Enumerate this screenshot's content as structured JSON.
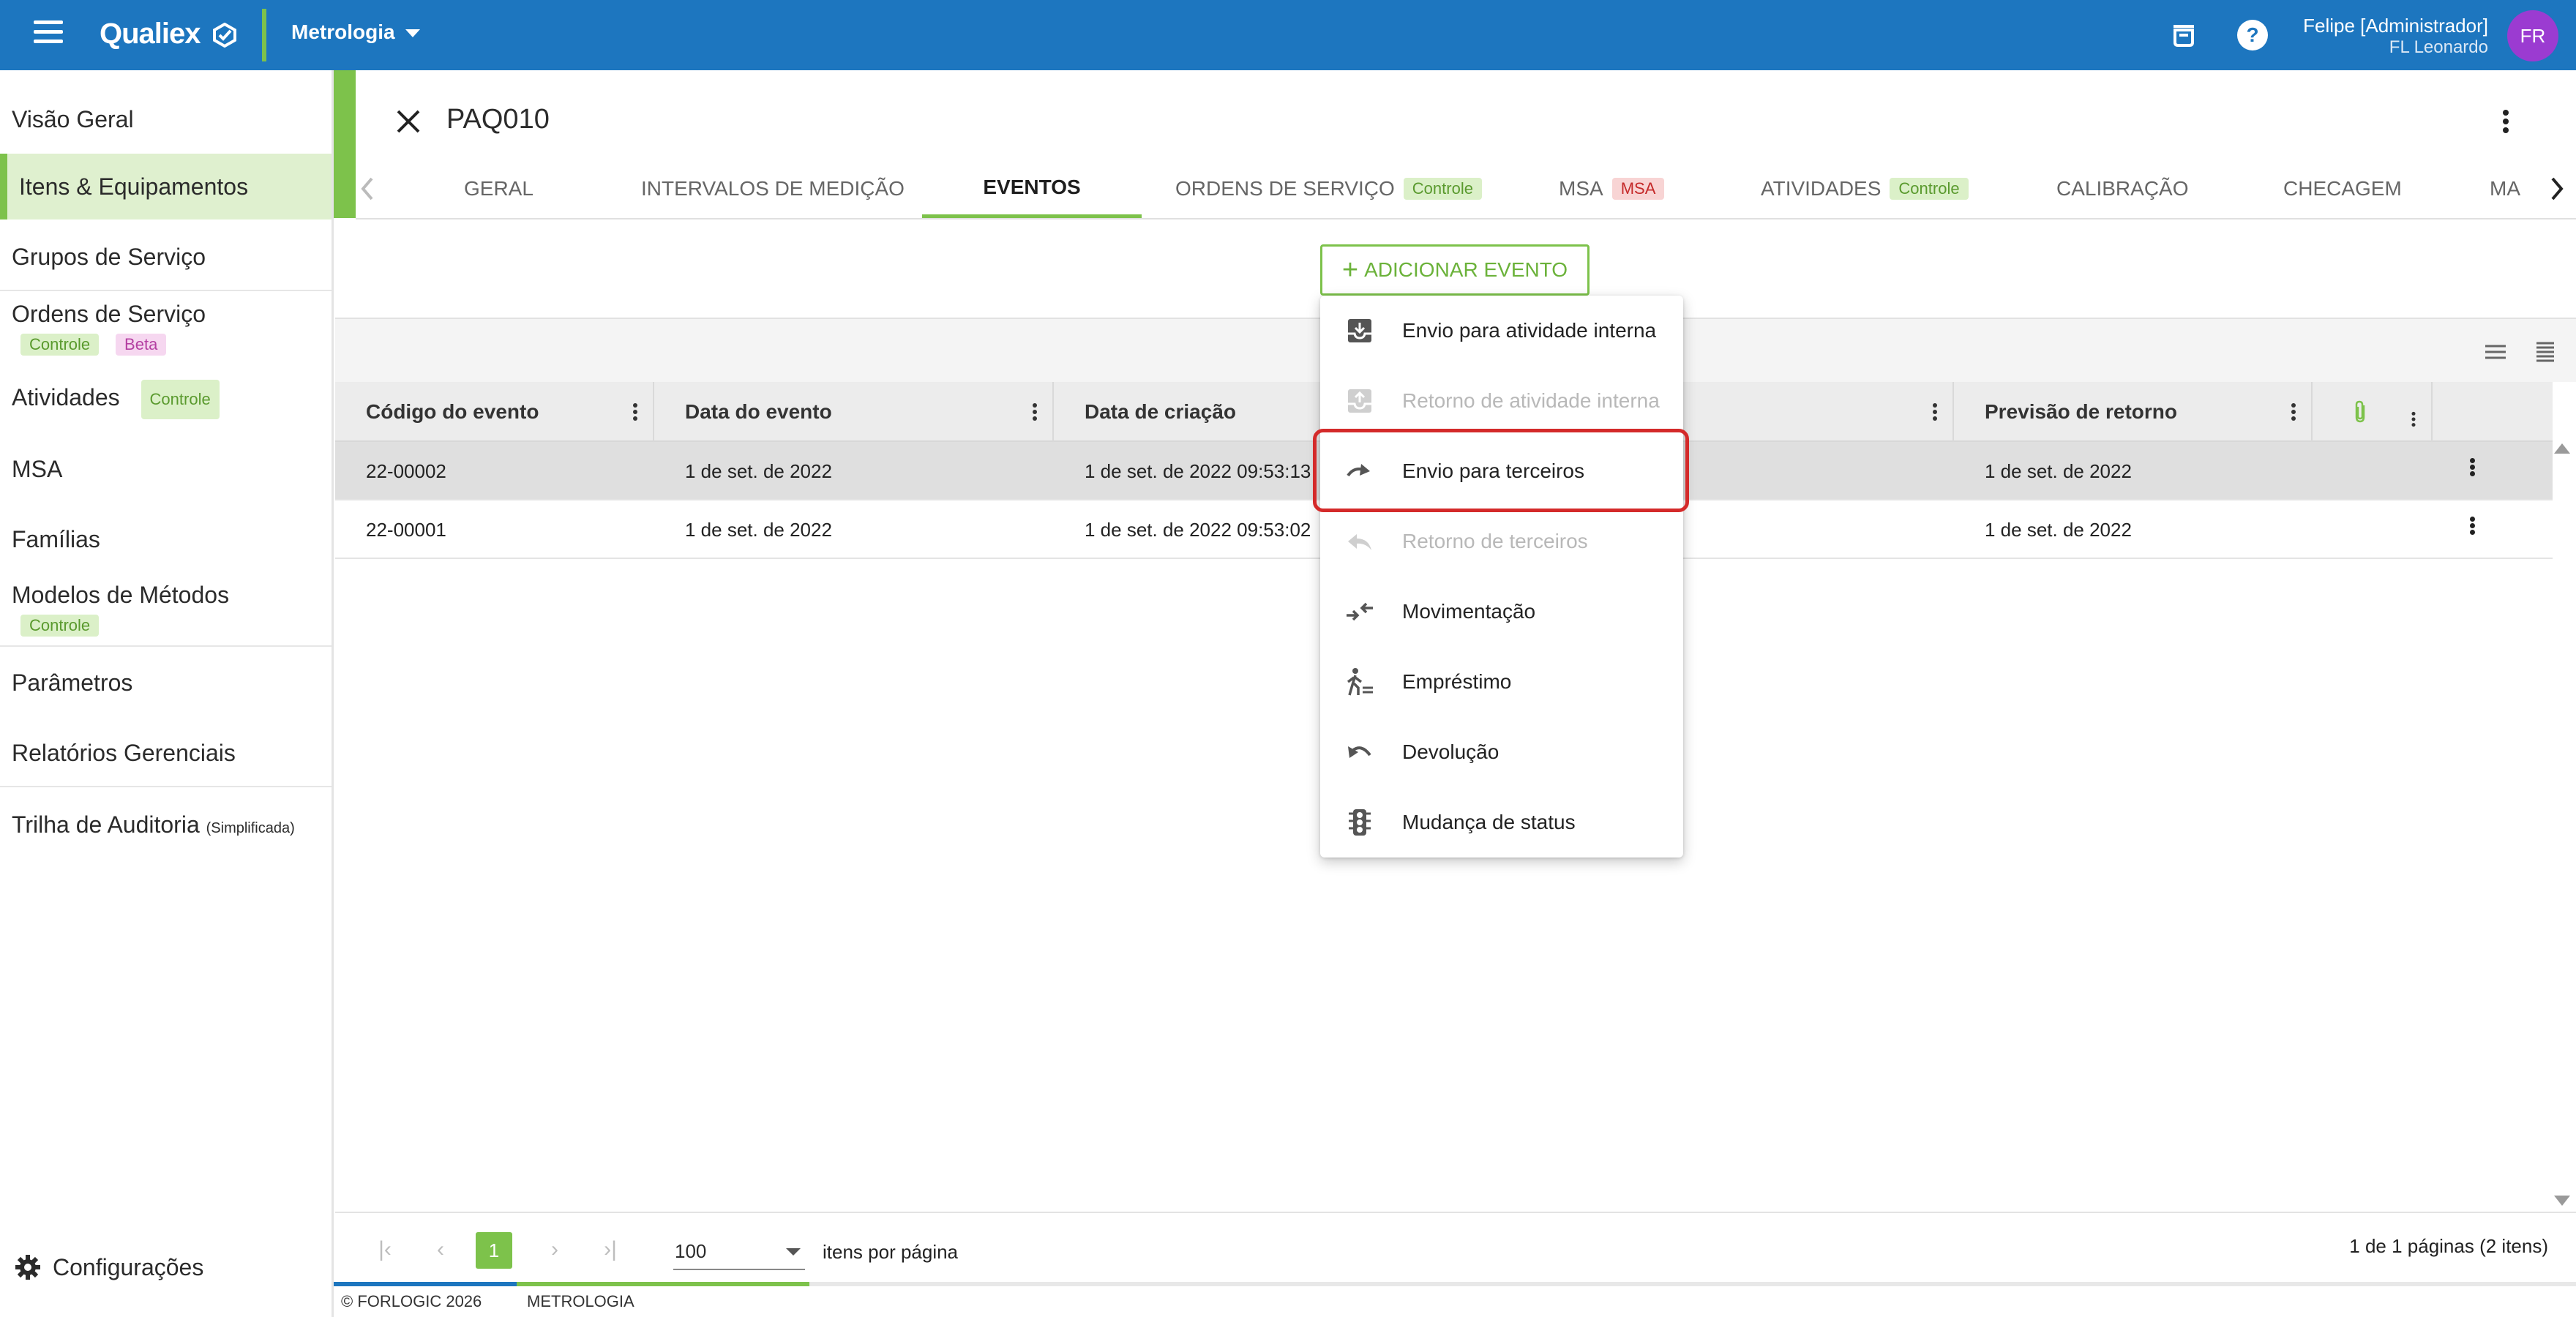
{
  "topbar": {
    "brand": "Qualiex",
    "module": "Metrologia",
    "user_name": "Felipe [Administrador]",
    "user_company": "FL Leonardo",
    "avatar_initials": "FR"
  },
  "sidebar": {
    "items": [
      {
        "label": "Visão Geral"
      },
      {
        "label": "Itens & Equipamentos"
      },
      {
        "label": "Grupos de Serviço"
      },
      {
        "label": "Ordens de Serviço",
        "tags": [
          "Controle",
          "Beta"
        ]
      },
      {
        "label": "Atividades",
        "tags": [
          "Controle"
        ]
      },
      {
        "label": "MSA"
      },
      {
        "label": "Famílias"
      },
      {
        "label": "Modelos de Métodos",
        "tags": [
          "Controle"
        ]
      },
      {
        "label": "Parâmetros"
      },
      {
        "label": "Relatórios Gerenciais"
      },
      {
        "label": "Trilha de Auditoria",
        "note": "(Simplificada)"
      }
    ],
    "settings_label": "Configurações"
  },
  "page": {
    "title": "PAQ010",
    "tabs": [
      {
        "label": "GERAL"
      },
      {
        "label": "INTERVALOS DE MEDIÇÃO"
      },
      {
        "label": "EVENTOS"
      },
      {
        "label": "ORDENS DE SERVIÇO",
        "tag": "Controle"
      },
      {
        "label": "MSA",
        "tag": "MSA"
      },
      {
        "label": "ATIVIDADES",
        "tag": "Controle"
      },
      {
        "label": "CALIBRAÇÃO"
      },
      {
        "label": "CHECAGEM"
      },
      {
        "label": "MA"
      }
    ],
    "add_button": "ADICIONAR EVENTO"
  },
  "table": {
    "columns": [
      "Código do evento",
      "Data do evento",
      "Data de criação",
      "Previsão de retorno"
    ],
    "rows": [
      {
        "code": "22-00002",
        "event_date": "1 de set. de 2022",
        "created": "1 de set. de 2022 09:53:13",
        "return": "1 de set. de 2022"
      },
      {
        "code": "22-00001",
        "event_date": "1 de set. de 2022",
        "created": "1 de set. de 2022 09:53:02",
        "return": "1 de set. de 2022"
      }
    ]
  },
  "menu": {
    "items": [
      {
        "label": "Envio para atividade interna",
        "icon": "inbox-out-icon",
        "enabled": true
      },
      {
        "label": "Retorno de atividade interna",
        "icon": "inbox-in-icon",
        "enabled": false
      },
      {
        "label": "Envio para terceiros",
        "icon": "redo-arrow-icon",
        "enabled": true
      },
      {
        "label": "Retorno de terceiros",
        "icon": "reply-icon",
        "enabled": false
      },
      {
        "label": "Movimentação",
        "icon": "move-arrows-icon",
        "enabled": true
      },
      {
        "label": "Empréstimo",
        "icon": "walking-person-icon",
        "enabled": true
      },
      {
        "label": "Devolução",
        "icon": "undo-icon",
        "enabled": true
      },
      {
        "label": "Mudança de status",
        "icon": "traffic-light-icon",
        "enabled": true
      }
    ],
    "highlighted_item": "Envio para terceiros"
  },
  "paginator": {
    "current_page": "1",
    "page_size": "100",
    "per_page_label": "itens por página",
    "range_label": "1 de 1 páginas (2 itens)"
  },
  "footer": {
    "copyright": "© FORLOGIC 2026",
    "module": "METROLOGIA"
  },
  "colors": {
    "primary_blue": "#1d76bf",
    "accent_green": "#7dc24b",
    "avatar_purple": "#9b3bd1",
    "highlight_red": "#d42a2a"
  }
}
